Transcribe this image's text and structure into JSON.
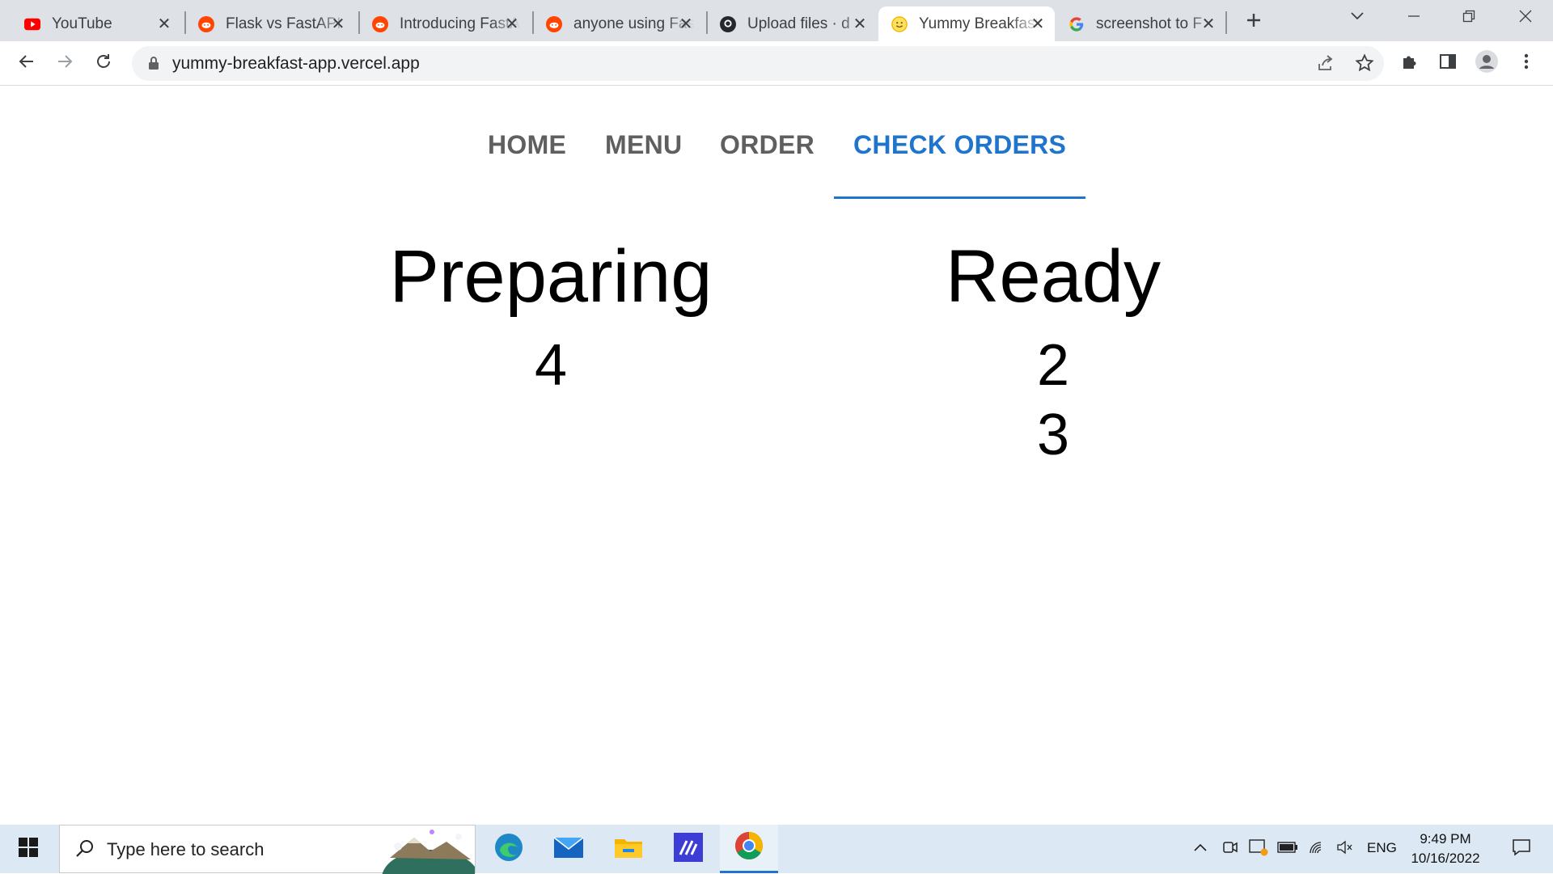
{
  "browser": {
    "tabs": [
      {
        "title": "YouTube",
        "icon": "youtube-icon"
      },
      {
        "title": "Flask vs FastAPI",
        "icon": "reddit-icon"
      },
      {
        "title": "Introducing FastAPI",
        "icon": "reddit-icon"
      },
      {
        "title": "anyone using FastAPI",
        "icon": "reddit-icon"
      },
      {
        "title": "Upload files · d",
        "icon": "github-icon"
      },
      {
        "title": "Yummy Breakfast",
        "icon": "smiley-icon",
        "active": true
      },
      {
        "title": "screenshot to F",
        "icon": "google-icon"
      }
    ],
    "url": "yummy-breakfast-app.vercel.app"
  },
  "nav": {
    "items": [
      "HOME",
      "MENU",
      "ORDER",
      "CHECK ORDERS"
    ],
    "active": "CHECK ORDERS"
  },
  "orders": {
    "preparing": {
      "heading": "Preparing",
      "numbers": [
        "4"
      ]
    },
    "ready": {
      "heading": "Ready",
      "numbers": [
        "2",
        "3"
      ]
    }
  },
  "taskbar": {
    "search_placeholder": "Type here to search",
    "language": "ENG",
    "time": "9:49 PM",
    "date": "10/16/2022"
  },
  "colors": {
    "accent": "#1f74cc",
    "nav_text": "#5f5f5f",
    "tabstrip_bg": "#dee1e6",
    "taskbar_bg": "#dce8f3"
  }
}
